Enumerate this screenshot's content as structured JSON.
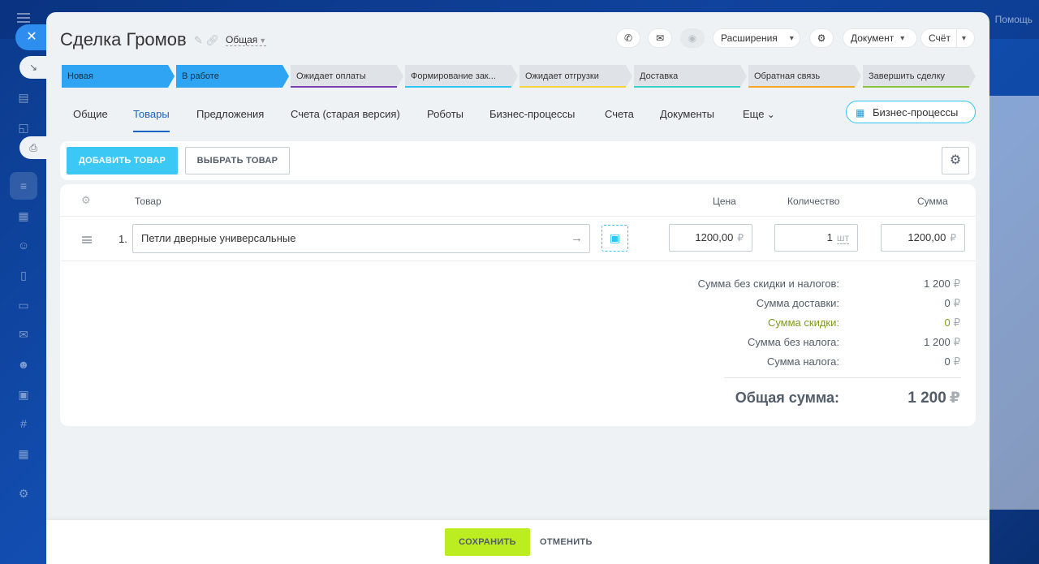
{
  "background": {
    "help": "Помощь"
  },
  "deal": {
    "title": "Сделка Громов",
    "category": "Общая"
  },
  "header": {
    "extensions": "Расширения",
    "document": "Документ",
    "invoice": "Счёт"
  },
  "stages": [
    {
      "label": "Новая",
      "state": "active",
      "color": "#2fa4f2"
    },
    {
      "label": "В работе",
      "state": "active",
      "color": "#2fa4f2"
    },
    {
      "label": "Ожидает оплаты",
      "state": "idle",
      "color": "#7b3fb3"
    },
    {
      "label": "Формирование зак...",
      "state": "idle",
      "color": "#2fc6f6"
    },
    {
      "label": "Ожидает отгрузки",
      "state": "idle",
      "color": "#f5d33b"
    },
    {
      "label": "Доставка",
      "state": "idle",
      "color": "#3bd3c6"
    },
    {
      "label": "Обратная связь",
      "state": "idle",
      "color": "#f5a623"
    },
    {
      "label": "Завершить сделку",
      "state": "idle",
      "color": "#8bc53f"
    }
  ],
  "tabs": [
    {
      "label": "Общие",
      "active": false
    },
    {
      "label": "Товары",
      "active": true
    },
    {
      "label": "Предложения",
      "active": false
    },
    {
      "label": "Счета (старая версия)",
      "active": false
    },
    {
      "label": "Роботы",
      "active": false
    },
    {
      "label": "Бизнес-процессы",
      "active": false
    },
    {
      "label": "Счета",
      "active": false
    },
    {
      "label": "Документы",
      "active": false
    },
    {
      "label": "Еще",
      "active": false
    }
  ],
  "bp_button": "Бизнес-процессы",
  "toolbar": {
    "add": "ДОБАВИТЬ ТОВАР",
    "choose": "ВЫБРАТЬ ТОВАР"
  },
  "table": {
    "columns": {
      "product": "Товар",
      "price": "Цена",
      "qty": "Количество",
      "sum": "Сумма"
    },
    "rows": [
      {
        "num": "1.",
        "product": "Петли дверные универсальные",
        "price": "1200,00",
        "currency": "₽",
        "qty": "1",
        "unit": "шт",
        "sum": "1200,00"
      }
    ]
  },
  "summary": [
    {
      "label": "Сумма без скидки и налогов:",
      "value": "1 200",
      "cur": "₽",
      "highlight": false
    },
    {
      "label": "Сумма доставки:",
      "value": "0",
      "cur": "₽",
      "highlight": false
    },
    {
      "label": "Сумма скидки:",
      "value": "0",
      "cur": "₽",
      "highlight": true
    },
    {
      "label": "Сумма без налога:",
      "value": "1 200",
      "cur": "₽",
      "highlight": false
    },
    {
      "label": "Сумма налога:",
      "value": "0",
      "cur": "₽",
      "highlight": false
    }
  ],
  "total": {
    "label": "Общая сумма:",
    "value": "1 200",
    "cur": "₽"
  },
  "footer": {
    "save": "СОХРАНИТЬ",
    "cancel": "ОТМЕНИТЬ"
  },
  "colors": {
    "accent": "#2fc6f6",
    "save": "#bbed21",
    "link": "#1a63c4"
  }
}
